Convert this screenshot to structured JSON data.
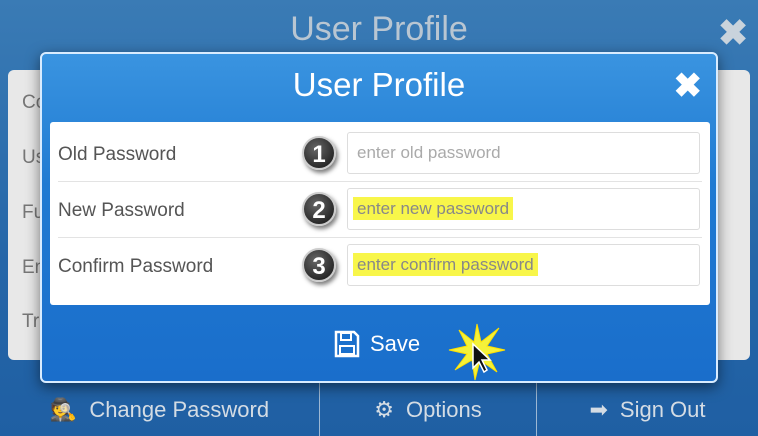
{
  "background": {
    "title": "User Profile",
    "rows": [
      "Co",
      "Us",
      "Fu",
      "Em",
      "Tra"
    ]
  },
  "modal": {
    "title": "User Profile",
    "fields": [
      {
        "step": "1",
        "label": "Old Password",
        "placeholder": "enter old password",
        "highlighted": false
      },
      {
        "step": "2",
        "label": "New Password",
        "placeholder": "enter new password",
        "highlighted": true
      },
      {
        "step": "3",
        "label": "Confirm Password",
        "placeholder": "enter confirm password",
        "highlighted": true
      }
    ],
    "save_label": "Save"
  },
  "footer": {
    "items": [
      {
        "label": "Change Password",
        "icon": "user-secret-icon"
      },
      {
        "label": "Options",
        "icon": "gears-icon"
      },
      {
        "label": "Sign Out",
        "icon": "sign-out-icon"
      }
    ]
  },
  "colors": {
    "modal": "#1f7ad2",
    "highlight": "#f8f64a",
    "background": "#2566a8"
  }
}
